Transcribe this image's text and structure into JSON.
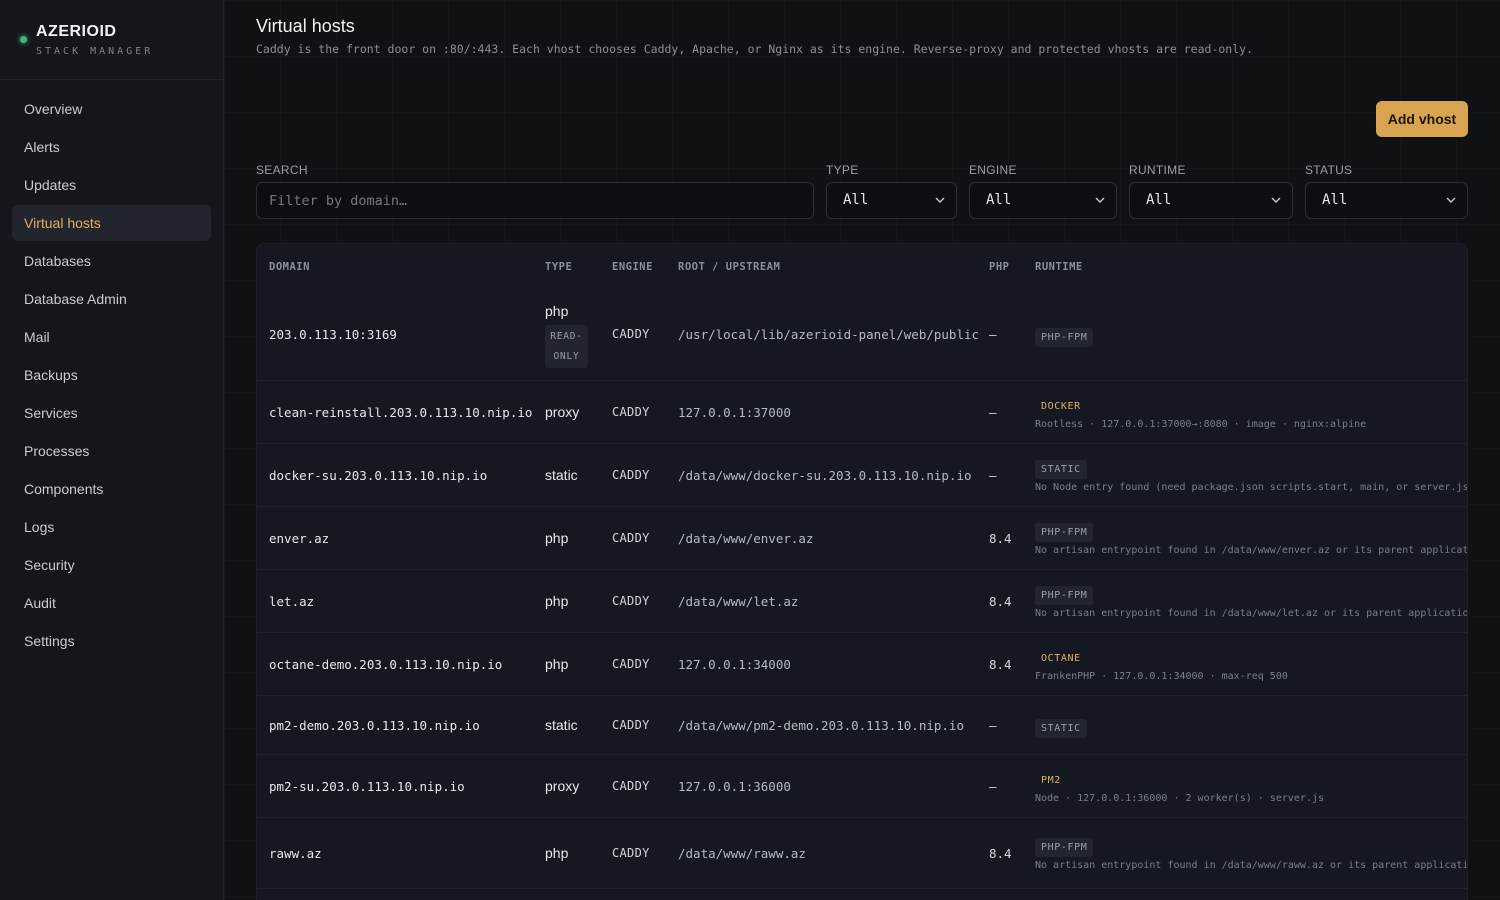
{
  "brand": {
    "name": "AZERIOID",
    "subtitle": "STACK MANAGER"
  },
  "nav": [
    {
      "label": "Overview",
      "active": false
    },
    {
      "label": "Alerts",
      "active": false
    },
    {
      "label": "Updates",
      "active": false
    },
    {
      "label": "Virtual hosts",
      "active": true
    },
    {
      "label": "Databases",
      "active": false
    },
    {
      "label": "Database Admin",
      "active": false
    },
    {
      "label": "Mail",
      "active": false
    },
    {
      "label": "Backups",
      "active": false
    },
    {
      "label": "Services",
      "active": false
    },
    {
      "label": "Processes",
      "active": false
    },
    {
      "label": "Components",
      "active": false
    },
    {
      "label": "Logs",
      "active": false
    },
    {
      "label": "Security",
      "active": false
    },
    {
      "label": "Audit",
      "active": false
    },
    {
      "label": "Settings",
      "active": false
    }
  ],
  "page": {
    "title": "Virtual hosts",
    "subtitle": "Caddy is the front door on :80/:443. Each vhost chooses Caddy, Apache, or Nginx as its engine. Reverse-proxy and protected vhosts are read-only.",
    "add_button": "Add vhost"
  },
  "filters": {
    "search_label": "SEARCH",
    "search_placeholder": "Filter by domain…",
    "search_value": "",
    "type_label": "TYPE",
    "type_value": "All",
    "engine_label": "ENGINE",
    "engine_value": "All",
    "runtime_label": "RUNTIME",
    "runtime_value": "All",
    "status_label": "STATUS",
    "status_value": "All"
  },
  "table": {
    "headers": {
      "domain": "DOMAIN",
      "type": "TYPE",
      "engine": "ENGINE",
      "root": "ROOT / UPSTREAM",
      "php": "PHP",
      "runtime": "RUNTIME"
    },
    "rows": [
      {
        "domain": "203.0.113.10:3169",
        "type": "php",
        "readonly_line1": "READ-",
        "readonly_line2": "ONLY",
        "engine": "CADDY",
        "root": "/usr/local/lib/azerioid-panel/web/public",
        "php": "—",
        "runtime": "PHP-FPM",
        "runtime_warn": false,
        "runtime_detail": ""
      },
      {
        "domain": "clean-reinstall.203.0.113.10.nip.io",
        "type": "proxy",
        "engine": "CADDY",
        "root": "127.0.0.1:37000",
        "php": "—",
        "runtime": "DOCKER",
        "runtime_warn": true,
        "runtime_detail": "Rootless · 127.0.0.1:37000→:8080 · image · nginx:alpine"
      },
      {
        "domain": "docker-su.203.0.113.10.nip.io",
        "type": "static",
        "engine": "CADDY",
        "root": "/data/www/docker-su.203.0.113.10.nip.io",
        "php": "—",
        "runtime": "STATIC",
        "runtime_warn": false,
        "runtime_detail": "No Node entry found (need package.json scripts.start, main, or server.js, app.js)"
      },
      {
        "domain": "enver.az",
        "type": "php",
        "engine": "CADDY",
        "root": "/data/www/enver.az",
        "php": "8.4",
        "runtime": "PHP-FPM",
        "runtime_warn": false,
        "runtime_detail": "No artisan entrypoint found in /data/www/enver.az or its parent application"
      },
      {
        "domain": "let.az",
        "type": "php",
        "engine": "CADDY",
        "root": "/data/www/let.az",
        "php": "8.4",
        "runtime": "PHP-FPM",
        "runtime_warn": false,
        "runtime_detail": "No artisan entrypoint found in /data/www/let.az or its parent application"
      },
      {
        "domain": "octane-demo.203.0.113.10.nip.io",
        "type": "php",
        "engine": "CADDY",
        "root": "127.0.0.1:34000",
        "php": "8.4",
        "runtime": "OCTANE",
        "runtime_warn": true,
        "runtime_detail": "FrankenPHP · 127.0.0.1:34000 · max-req 500"
      },
      {
        "domain": "pm2-demo.203.0.113.10.nip.io",
        "type": "static",
        "engine": "CADDY",
        "root": "/data/www/pm2-demo.203.0.113.10.nip.io",
        "php": "—",
        "runtime": "STATIC",
        "runtime_warn": false,
        "runtime_detail": ""
      },
      {
        "domain": "pm2-su.203.0.113.10.nip.io",
        "type": "proxy",
        "engine": "CADDY",
        "root": "127.0.0.1:36000",
        "php": "—",
        "runtime": "PM2",
        "runtime_warn": true,
        "runtime_detail": "Node · 127.0.0.1:36000 · 2 worker(s) · server.js"
      },
      {
        "domain": "raww.az",
        "type": "php",
        "engine": "CADDY",
        "root": "/data/www/raww.az",
        "php": "8.4",
        "runtime": "PHP-FPM",
        "runtime_warn": false,
        "runtime_detail": "No artisan entrypoint found in /data/www/raww.az or its parent application"
      }
    ]
  }
}
